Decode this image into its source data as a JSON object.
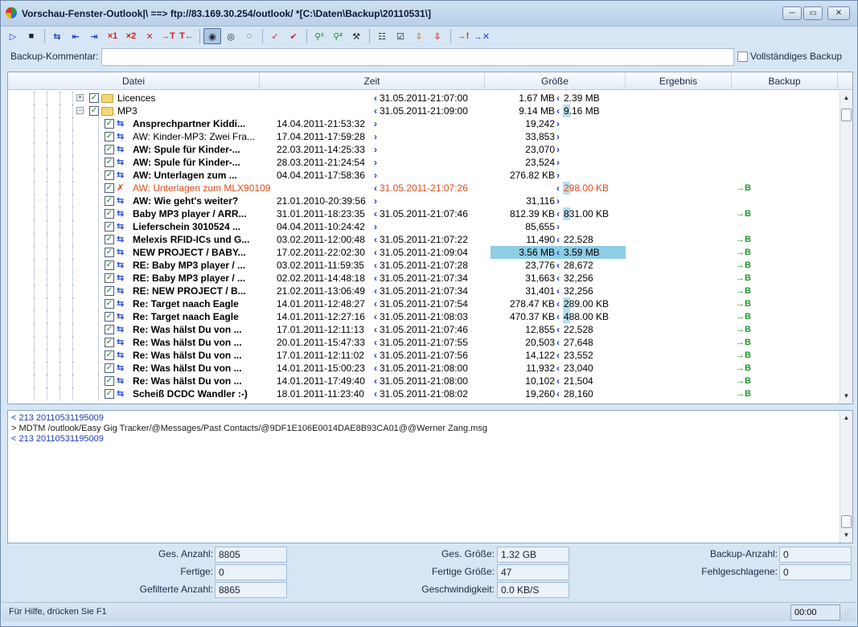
{
  "window": {
    "title": "Vorschau-Fenster-Outlook|\\ ==> ftp://83.169.30.254/outlook/ *[C:\\Daten\\Backup\\20110531\\]",
    "minimize": "─",
    "maximize": "▭",
    "close": "✕"
  },
  "toolbar": {
    "groups": [
      [
        {
          "icon": "play-icon",
          "glyph": "▷",
          "color": "blue"
        },
        {
          "icon": "stop-icon",
          "glyph": "■",
          "color": "dark"
        }
      ],
      [
        {
          "icon": "sync-both-icon",
          "glyph": "⇆",
          "color": "blue"
        },
        {
          "icon": "upload-left-icon",
          "glyph": "⇤",
          "color": "blue"
        },
        {
          "icon": "upload-right-icon",
          "glyph": "⇥",
          "color": "blue"
        },
        {
          "icon": "delete-one-icon",
          "glyph": "×1",
          "color": "red"
        },
        {
          "icon": "delete-two-icon",
          "glyph": "×2",
          "color": "red"
        },
        {
          "icon": "delete-icon",
          "glyph": "✕",
          "color": "red"
        },
        {
          "icon": "transfer-t-icon",
          "glyph": "→T",
          "color": "red"
        },
        {
          "icon": "transfer-t-back-icon",
          "glyph": "T←",
          "color": "red"
        }
      ],
      [
        {
          "icon": "view-all-icon",
          "glyph": "◉",
          "color": "dark",
          "active": true
        },
        {
          "icon": "view-changed-icon",
          "glyph": "◎",
          "color": "dark"
        },
        {
          "icon": "view-hidden-icon",
          "glyph": "◌",
          "color": "dark"
        }
      ],
      [
        {
          "icon": "check-arrow-icon",
          "glyph": "✓",
          "color": "red"
        },
        {
          "icon": "check-arrow-alt-icon",
          "glyph": "✔",
          "color": "red"
        }
      ],
      [
        {
          "icon": "find-one-icon",
          "glyph": "⚲¹",
          "color": "green"
        },
        {
          "icon": "find-two-icon",
          "glyph": "⚲²",
          "color": "green"
        },
        {
          "icon": "filter-icon",
          "glyph": "⚒",
          "color": "dark"
        }
      ],
      [
        {
          "icon": "tree-icon",
          "glyph": "☷",
          "color": "dark"
        },
        {
          "icon": "select-all-icon",
          "glyph": "☑",
          "color": "dark"
        },
        {
          "icon": "download-icon",
          "glyph": "⇩",
          "color": "orange"
        },
        {
          "icon": "download-alt-icon",
          "glyph": "⇩",
          "color": "red"
        }
      ],
      [
        {
          "icon": "alert-arrow-icon",
          "glyph": "→!",
          "color": "red"
        },
        {
          "icon": "cancel-arrow-icon",
          "glyph": "→✕",
          "color": "blue"
        }
      ]
    ]
  },
  "comment": {
    "label": "Backup-Kommentar:",
    "value": "",
    "full_backup_label": "Vollständiges Backup",
    "full_backup_checked": false
  },
  "table": {
    "columns": [
      "Datei",
      "Zeit",
      "Größe",
      "Ergebnis",
      "Backup"
    ],
    "rows": [
      {
        "kind": "folder",
        "name": "Licences",
        "level": 0,
        "expander": "+",
        "time1": "",
        "time2": "31.05.2011-21:07:00",
        "arrow_time": "left",
        "size1": "1.67 MB",
        "size2": "2.39 MB",
        "arrow_size": "left",
        "result": ""
      },
      {
        "kind": "folder",
        "name": "MP3",
        "level": 0,
        "expander": "−",
        "time1": "",
        "time2": "31.05.2011-21:09:00",
        "arrow_time": "left",
        "size1": "9.14 MB",
        "size2": "9.16 MB",
        "arrow_size": "left",
        "size_hl": true,
        "result": ""
      },
      {
        "kind": "file",
        "name": "Ansprechpartner  Kiddi...",
        "bold": true,
        "time1": "14.04.2011-21:53:32",
        "time2": "",
        "arrow_time": "right",
        "size1": "19,242",
        "size2": "",
        "arrow_size": "right",
        "result": ""
      },
      {
        "kind": "file",
        "name": "AW: Kinder-MP3: Zwei Fra...",
        "bold": false,
        "time1": "17.04.2011-17:59:28",
        "time2": "",
        "arrow_time": "right",
        "size1": "33,853",
        "size2": "",
        "arrow_size": "right",
        "result": ""
      },
      {
        "kind": "file",
        "name": "AW: Spule für Kinder-...",
        "bold": true,
        "time1": "22.03.2011-14:25:33",
        "time2": "",
        "arrow_time": "right",
        "size1": "23,070",
        "size2": "",
        "arrow_size": "right",
        "result": ""
      },
      {
        "kind": "file",
        "name": "AW: Spule für Kinder-...",
        "bold": true,
        "time1": "28.03.2011-21:24:54",
        "time2": "",
        "arrow_time": "right",
        "size1": "23,524",
        "size2": "",
        "arrow_size": "right",
        "result": ""
      },
      {
        "kind": "file",
        "name": "AW: Unterlagen zum ...",
        "bold": true,
        "time1": "04.04.2011-17:58:36",
        "time2": "",
        "arrow_time": "right",
        "size1": "276.82 KB",
        "size2": "",
        "arrow_size": "right",
        "result": ""
      },
      {
        "kind": "file",
        "name": "AW: Unterlagen zum MLX90109",
        "bold": false,
        "err": true,
        "time1": "",
        "time2": "31.05.2011-21:07:26",
        "arrow_time": "left",
        "size1": "",
        "size2": "298.00 KB",
        "arrow_size": "left",
        "size_hl": true,
        "result": "→B"
      },
      {
        "kind": "file",
        "name": "AW: Wie geht's weiter?",
        "bold": true,
        "time1": "21.01.2010-20:39:56",
        "time2": "",
        "arrow_time": "right",
        "size1": "31,116",
        "size2": "",
        "arrow_size": "right",
        "result": ""
      },
      {
        "kind": "file",
        "name": "Baby MP3 player / ARR...",
        "bold": true,
        "time1": "31.01.2011-18:23:35",
        "time2": "31.05.2011-21:07:46",
        "arrow_time": "left",
        "size1": "812.39 KB",
        "size2": "831.00 KB",
        "arrow_size": "left",
        "size_hl": true,
        "result": "→B"
      },
      {
        "kind": "file",
        "name": "Lieferschein 3010524 ...",
        "bold": true,
        "time1": "04.04.2011-10:24:42",
        "time2": "",
        "arrow_time": "right",
        "size1": "85,655",
        "size2": "",
        "arrow_size": "right",
        "result": ""
      },
      {
        "kind": "file",
        "name": "Melexis RFID-ICs und G...",
        "bold": true,
        "time1": "03.02.2011-12:00:48",
        "time2": "31.05.2011-21:07:22",
        "arrow_time": "left",
        "size1": "11,490",
        "size2": "22,528",
        "arrow_size": "left",
        "result": "→B"
      },
      {
        "kind": "file",
        "name": "NEW PROJECT / BABY...",
        "bold": true,
        "time1": "17.02.2011-22:02:30",
        "time2": "31.05.2011-21:09:04",
        "arrow_time": "left",
        "size1": "3.56 MB",
        "size2": "3.59 MB",
        "arrow_size": "left",
        "row_hl": true,
        "result": "→B"
      },
      {
        "kind": "file",
        "name": "RE: Baby MP3 player / ...",
        "bold": true,
        "time1": "03.02.2011-11:59:35",
        "time2": "31.05.2011-21:07:28",
        "arrow_time": "left",
        "size1": "23,776",
        "size2": "28,672",
        "arrow_size": "left",
        "result": "→B"
      },
      {
        "kind": "file",
        "name": "RE: Baby MP3 player / ...",
        "bold": true,
        "time1": "02.02.2011-14:48:18",
        "time2": "31.05.2011-21:07:34",
        "arrow_time": "left",
        "size1": "31,663",
        "size2": "32,256",
        "arrow_size": "left",
        "result": "→B"
      },
      {
        "kind": "file",
        "name": "RE: NEW PROJECT / B...",
        "bold": true,
        "time1": "21.02.2011-13:06:49",
        "time2": "31.05.2011-21:07:34",
        "arrow_time": "left",
        "size1": "31,401",
        "size2": "32,256",
        "arrow_size": "left",
        "result": "→B"
      },
      {
        "kind": "file",
        "name": "Re: Target naach Eagle",
        "bold": true,
        "time1": "14.01.2011-12:48:27",
        "time2": "31.05.2011-21:07:54",
        "arrow_time": "left",
        "size1": "278.47 KB",
        "size2": "289.00 KB",
        "arrow_size": "left",
        "size_hl": true,
        "result": "→B"
      },
      {
        "kind": "file",
        "name": "Re: Target naach Eagle",
        "bold": true,
        "time1": "14.01.2011-12:27:16",
        "time2": "31.05.2011-21:08:03",
        "arrow_time": "left",
        "size1": "470.37 KB",
        "size2": "488.00 KB",
        "arrow_size": "left",
        "size_hl": true,
        "result": "→B"
      },
      {
        "kind": "file",
        "name": "Re: Was hälst Du von ...",
        "bold": true,
        "time1": "17.01.2011-12:11:13",
        "time2": "31.05.2011-21:07:46",
        "arrow_time": "left",
        "size1": "12,855",
        "size2": "22,528",
        "arrow_size": "left",
        "result": "→B"
      },
      {
        "kind": "file",
        "name": "Re: Was hälst Du von ...",
        "bold": true,
        "time1": "20.01.2011-15:47:33",
        "time2": "31.05.2011-21:07:55",
        "arrow_time": "left",
        "size1": "20,503",
        "size2": "27,648",
        "arrow_size": "left",
        "result": "→B"
      },
      {
        "kind": "file",
        "name": "Re: Was hälst Du von ...",
        "bold": true,
        "time1": "17.01.2011-12:11:02",
        "time2": "31.05.2011-21:07:56",
        "arrow_time": "left",
        "size1": "14,122",
        "size2": "23,552",
        "arrow_size": "left",
        "result": "→B"
      },
      {
        "kind": "file",
        "name": "Re: Was hälst Du von ...",
        "bold": true,
        "time1": "14.01.2011-15:00:23",
        "time2": "31.05.2011-21:08:00",
        "arrow_time": "left",
        "size1": "11,932",
        "size2": "23,040",
        "arrow_size": "left",
        "result": "→B"
      },
      {
        "kind": "file",
        "name": "Re: Was hälst Du von ...",
        "bold": true,
        "time1": "14.01.2011-17:49:40",
        "time2": "31.05.2011-21:08:00",
        "arrow_time": "left",
        "size1": "10,102",
        "size2": "21,504",
        "arrow_size": "left",
        "result": "→B"
      },
      {
        "kind": "file",
        "name": "Scheiß DCDC Wandler :-)",
        "bold": true,
        "time1": "18.01.2011-11:23:40",
        "time2": "31.05.2011-21:08:02",
        "arrow_time": "left",
        "size1": "19,260",
        "size2": "28,160",
        "arrow_size": "left",
        "result": "→B"
      }
    ]
  },
  "log": {
    "lines": [
      {
        "dir": "in",
        "text": "< 213 20110531195009"
      },
      {
        "dir": "out",
        "text": "> MDTM /outlook/Easy Gig Tracker/@Messages/Past Contacts/@9DF1E106E0014DAE8B93CA01@@Werner Zang.msg"
      },
      {
        "dir": "in",
        "text": "< 213 20110531195009"
      }
    ]
  },
  "stats": {
    "total_count_label": "Ges. Anzahl:",
    "total_count": "8805",
    "done_label": "Fertige:",
    "done": "0",
    "filtered_label": "Gefilterte Anzahl:",
    "filtered": "8865",
    "total_size_label": "Ges. Größe:",
    "total_size": "1.32 GB",
    "done_size_label": "Fertige Größe:",
    "done_size": "47",
    "speed_label": "Geschwindigkeit:",
    "speed": "0.0 KB/S",
    "backup_count_label": "Backup-Anzahl:",
    "backup_count": "0",
    "failed_label": "Fehlgeschlagene:",
    "failed": "0"
  },
  "status": {
    "help_text": "Für Hilfe, drücken Sie F1",
    "time": "00:00"
  }
}
